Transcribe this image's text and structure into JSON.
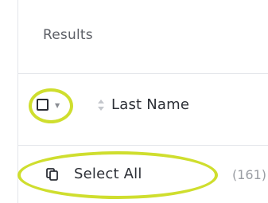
{
  "panel": {
    "title": "Results"
  },
  "table": {
    "header": {
      "sort_column_label": "Last Name"
    },
    "select_menu": {
      "select_all_label": "Select All",
      "count_text": "(161)"
    }
  },
  "icons": {
    "checkbox": "checkbox-unchecked-icon",
    "dropdown": "caret-down-icon",
    "sort": "sort-icon",
    "copy": "copy-icon"
  },
  "colors": {
    "highlight": "#cfde2e"
  }
}
